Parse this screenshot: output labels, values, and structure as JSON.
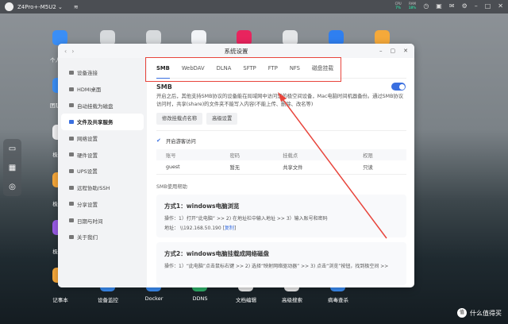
{
  "topbar": {
    "device": "Z4Pro+-M5U2",
    "cpu_label": "CPU",
    "cpu": "7%",
    "ram_label": "RAM",
    "ram": "18%"
  },
  "desktop": {
    "left": [
      "个人空间",
      "团队空间",
      "极相册",
      "极影视",
      "极音乐",
      "记事本"
    ],
    "bottom": [
      "设备监控",
      "Docker",
      "DDNS",
      "文档编辑",
      "高级搜索",
      "病毒查杀"
    ]
  },
  "window": {
    "title": "系统设置",
    "sidebar": [
      "设备连接",
      "HDMI桌面",
      "自动挂载为磁盘",
      "文件及共享服务",
      "网络设置",
      "硬件设置",
      "UPS设置",
      "远程协助/SSH",
      "分享设置",
      "日期与时间",
      "关于我们"
    ],
    "tabs": [
      "SMB",
      "WebDAV",
      "DLNA",
      "SFTP",
      "FTP",
      "NFS",
      "磁盘挂载"
    ],
    "smb": {
      "title": "SMB",
      "enabled": true,
      "desc": "开启之后，其他支持SMB协议的设备能在局域网中访问您的极空间设备，Mac电脑时间机器备份。通过SMB协议访问时，共享(share)的文件夹不能写入内容(不能上传、删除、改名等)",
      "btn_rename": "修改挂载点名称",
      "btn_adv": "高级设置",
      "guest_label": "开启游客访问",
      "guest_checked": true,
      "headers": [
        "账号",
        "密码",
        "挂载点",
        "权限"
      ],
      "rows": [
        [
          "guest",
          "暂无",
          "共享文件",
          "只读"
        ]
      ],
      "help_title": "SMB使用帮助",
      "m1_title": "方式1：windows电脑浏览",
      "m1_ops": "操作：1）打开“此电脑” >> 2) 在地址栏中输入地址 >> 3）输入账号和密码",
      "m1_addr": "地址： \\\\192.168.50.190 [",
      "m1_copy": "复制",
      "m1_close": "]",
      "m2_title": "方式2：windows电脑挂载成网络磁盘",
      "m2_ops": "操作：1）“此电脑”点击鼠标右键 >> 2) 选择“映射网络驱动器” >> 3) 点击“浏览”按钮，找到极空间 >>"
    }
  },
  "watermark": "什么值得买"
}
